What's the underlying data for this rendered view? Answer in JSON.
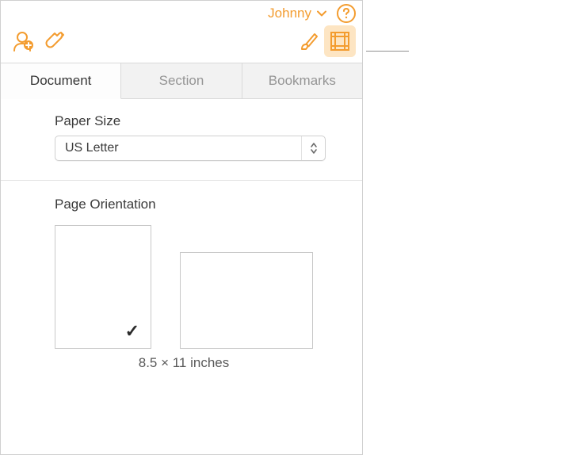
{
  "header": {
    "user": "Johnny"
  },
  "tabs": {
    "t0": "Document",
    "t1": "Section",
    "t2": "Bookmarks"
  },
  "paperSize": {
    "label": "Paper Size",
    "value": "US Letter"
  },
  "orientation": {
    "label": "Page Orientation",
    "dimensions": "8.5 × 11 inches"
  }
}
